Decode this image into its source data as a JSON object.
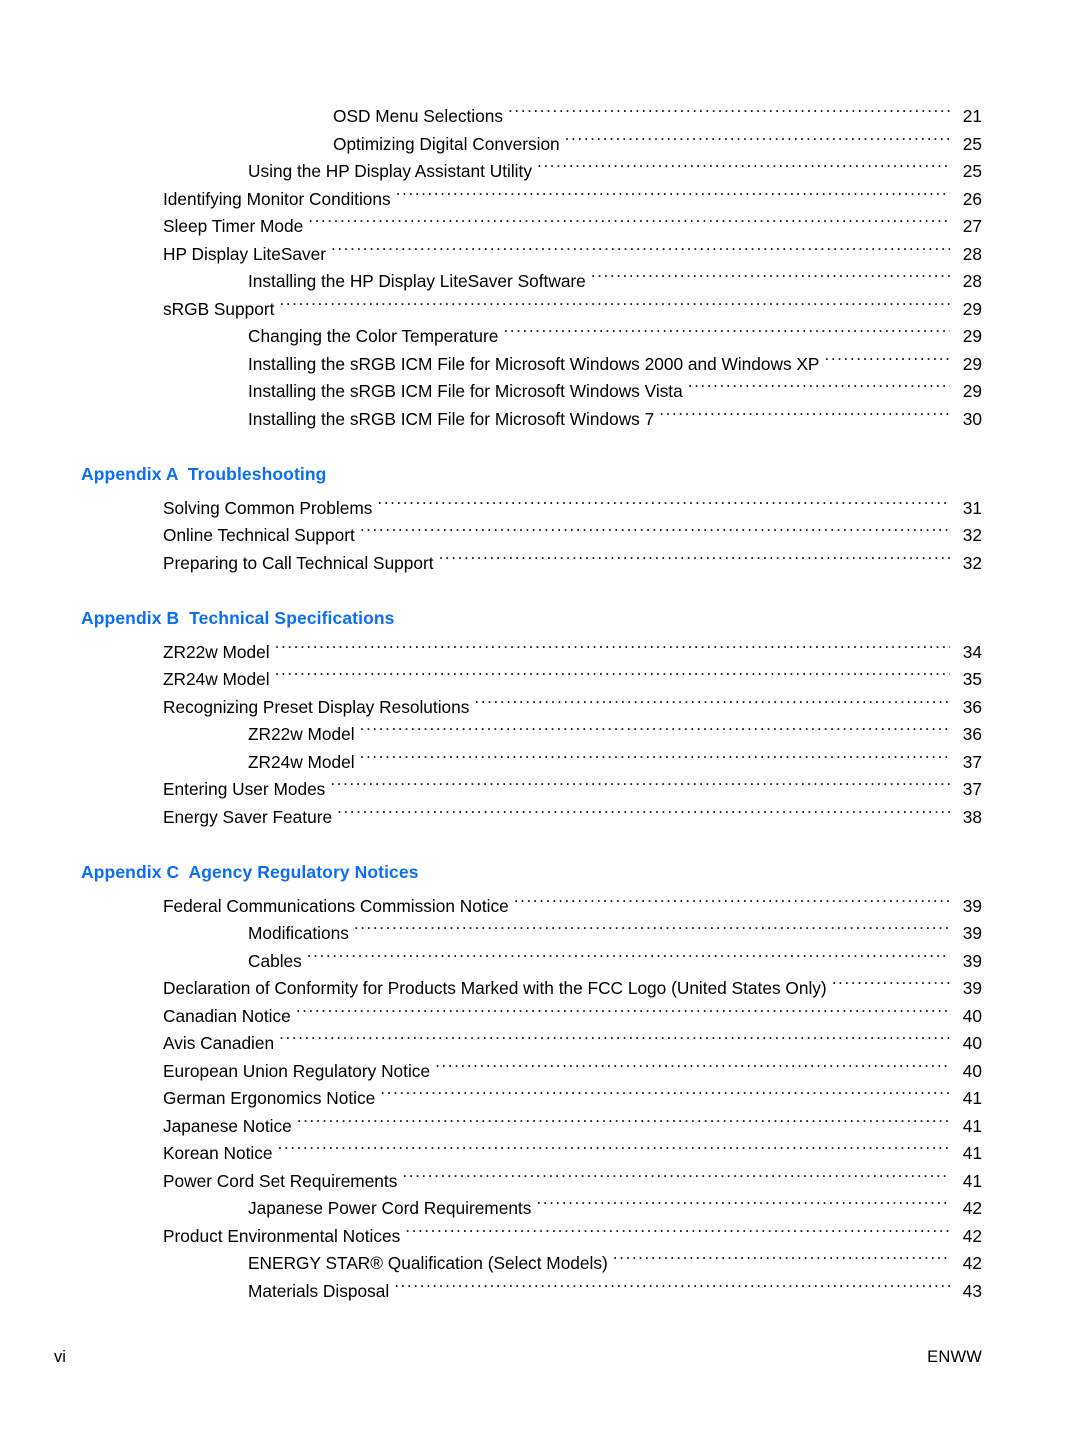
{
  "document": {
    "page_type": "table-of-contents-continued",
    "accent_color": "#0b6ef5",
    "text_color": "#000000",
    "background_color": "#ffffff"
  },
  "toc": {
    "sections": [
      {
        "heading": null,
        "entries": [
          {
            "label": "OSD Menu Selections",
            "page": "21",
            "level": 3
          },
          {
            "label": "Optimizing Digital Conversion",
            "page": "25",
            "level": 3
          },
          {
            "label": "Using the HP Display Assistant Utility",
            "page": "25",
            "level": 2
          },
          {
            "label": "Identifying Monitor Conditions",
            "page": "26",
            "level": 1
          },
          {
            "label": "Sleep Timer Mode",
            "page": "27",
            "level": 1
          },
          {
            "label": "HP Display LiteSaver",
            "page": "28",
            "level": 1
          },
          {
            "label": "Installing the HP Display LiteSaver Software",
            "page": "28",
            "level": 2
          },
          {
            "label": "sRGB Support",
            "page": "29",
            "level": 1
          },
          {
            "label": "Changing the Color Temperature",
            "page": "29",
            "level": 2
          },
          {
            "label": "Installing the sRGB ICM File for Microsoft Windows 2000 and Windows XP",
            "page": "29",
            "level": 2
          },
          {
            "label": "Installing the sRGB ICM File for Microsoft Windows Vista",
            "page": "29",
            "level": 2
          },
          {
            "label": "Installing the sRGB ICM File for Microsoft Windows 7",
            "page": "30",
            "level": 2
          }
        ]
      },
      {
        "heading": "Appendix A  Troubleshooting",
        "entries": [
          {
            "label": "Solving Common Problems",
            "page": "31",
            "level": 1
          },
          {
            "label": "Online Technical Support",
            "page": "32",
            "level": 1
          },
          {
            "label": "Preparing to Call Technical Support",
            "page": "32",
            "level": 1
          }
        ]
      },
      {
        "heading": "Appendix B  Technical Specifications",
        "entries": [
          {
            "label": "ZR22w Model",
            "page": "34",
            "level": 1
          },
          {
            "label": "ZR24w Model",
            "page": "35",
            "level": 1
          },
          {
            "label": "Recognizing Preset Display Resolutions",
            "page": "36",
            "level": 1
          },
          {
            "label": "ZR22w Model",
            "page": "36",
            "level": 2
          },
          {
            "label": "ZR24w Model",
            "page": "37",
            "level": 2
          },
          {
            "label": "Entering User Modes",
            "page": "37",
            "level": 1
          },
          {
            "label": "Energy Saver Feature",
            "page": "38",
            "level": 1
          }
        ]
      },
      {
        "heading": "Appendix C  Agency Regulatory Notices",
        "entries": [
          {
            "label": "Federal Communications Commission Notice",
            "page": "39",
            "level": 1
          },
          {
            "label": "Modifications",
            "page": "39",
            "level": 2
          },
          {
            "label": "Cables",
            "page": "39",
            "level": 2
          },
          {
            "label": "Declaration of Conformity for Products Marked with the FCC Logo (United States Only)",
            "page": "39",
            "level": 1
          },
          {
            "label": "Canadian Notice",
            "page": "40",
            "level": 1
          },
          {
            "label": "Avis Canadien",
            "page": "40",
            "level": 1
          },
          {
            "label": "European Union Regulatory Notice",
            "page": "40",
            "level": 1
          },
          {
            "label": "German Ergonomics Notice",
            "page": "41",
            "level": 1
          },
          {
            "label": "Japanese Notice",
            "page": "41",
            "level": 1
          },
          {
            "label": "Korean Notice",
            "page": "41",
            "level": 1
          },
          {
            "label": "Power Cord Set Requirements",
            "page": "41",
            "level": 1
          },
          {
            "label": "Japanese Power Cord Requirements",
            "page": "42",
            "level": 2
          },
          {
            "label": "Product Environmental Notices",
            "page": "42",
            "level": 1
          },
          {
            "label": "ENERGY STAR® Qualification (Select Models)",
            "page": "42",
            "level": 2
          },
          {
            "label": "Materials Disposal",
            "page": "43",
            "level": 2
          }
        ]
      }
    ]
  },
  "footer": {
    "page_number": "vi",
    "locale_code": "ENWW"
  }
}
